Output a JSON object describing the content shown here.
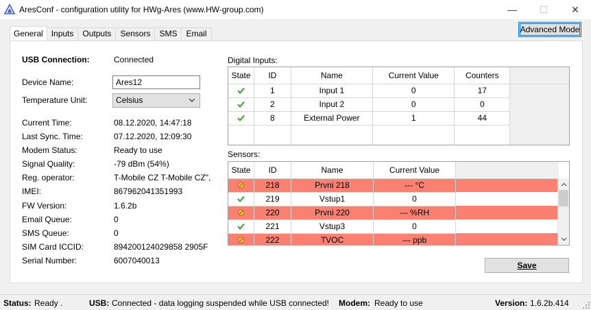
{
  "window": {
    "title": "AresConf - configuration utility for HWg-Ares (www.HW-group.com)",
    "minimize_glyph": "—",
    "maximize_glyph": "☐",
    "close_glyph": "✕"
  },
  "advanced_button": "Advanced Mode",
  "tabs": [
    {
      "label": "General",
      "active": true
    },
    {
      "label": "Inputs"
    },
    {
      "label": "Outputs"
    },
    {
      "label": "Sensors"
    },
    {
      "label": "SMS"
    },
    {
      "label": "Email"
    }
  ],
  "general": {
    "usb_connection_label": "USB Connection:",
    "usb_connection_value": "Connected",
    "device_name_label": "Device Name:",
    "device_name_value": "Ares12",
    "temp_unit_label": "Temperature Unit:",
    "temp_unit_value": "Celsius",
    "info": [
      {
        "label": "Current Time:",
        "value": "08.12.2020, 14:47:18"
      },
      {
        "label": "Last Sync. Time:",
        "value": "07.12.2020, 12:09:30"
      },
      {
        "label": "Modem Status:",
        "value": "Ready to use"
      },
      {
        "label": "Signal Quality:",
        "value": "-79 dBm (54%)"
      },
      {
        "label": "Reg. operator:",
        "value": "T-Mobile CZ T-Mobile CZ\","
      },
      {
        "label": "IMEI:",
        "value": "867962041351993"
      },
      {
        "label": "FW Version:",
        "value": "1.6.2b"
      },
      {
        "label": "Email Queue:",
        "value": "0"
      },
      {
        "label": "SMS Queue:",
        "value": "0"
      },
      {
        "label": "SIM Card ICCID:",
        "value": "894200124029858 2905F"
      },
      {
        "label": "Serial Number:",
        "value": "6007040013"
      }
    ]
  },
  "digital_inputs": {
    "title": "Digital Inputs:",
    "columns": [
      "State",
      "ID",
      "Name",
      "Current Value",
      "Counters"
    ],
    "rows": [
      {
        "state": "ok",
        "id": "1",
        "name": "Input 1",
        "value": "0",
        "counter": "17"
      },
      {
        "state": "ok",
        "id": "2",
        "name": "Input 2",
        "value": "0",
        "counter": "0"
      },
      {
        "state": "ok",
        "id": "8",
        "name": "External Power",
        "value": "1",
        "counter": "44"
      }
    ]
  },
  "sensors": {
    "title": "Sensors:",
    "columns": [
      "State",
      "ID",
      "Name",
      "Current Value"
    ],
    "rows": [
      {
        "state": "error",
        "id": "218",
        "name": "Prvni 218",
        "value": "--- °C"
      },
      {
        "state": "ok",
        "id": "219",
        "name": "Vstup1",
        "value": "0"
      },
      {
        "state": "error",
        "id": "220",
        "name": "Prvni 220",
        "value": "--- %RH"
      },
      {
        "state": "ok",
        "id": "221",
        "name": "Vstup3",
        "value": "0"
      },
      {
        "state": "error",
        "id": "222",
        "name": "TVOC",
        "value": "--- ppb"
      }
    ]
  },
  "save_button": "Save",
  "statusbar": {
    "status_label": "Status:",
    "status_value": "Ready .",
    "usb_label": "USB:",
    "usb_value": "Connected - data logging suspended while USB connected!",
    "modem_label": "Modem:",
    "modem_value": "Ready to use",
    "version_label": "Version:",
    "version_value": "1.6.2b.414"
  },
  "colors": {
    "error_row": "#fa8072",
    "ok_check": "#2e9e2e",
    "accent": "#0078d7"
  }
}
